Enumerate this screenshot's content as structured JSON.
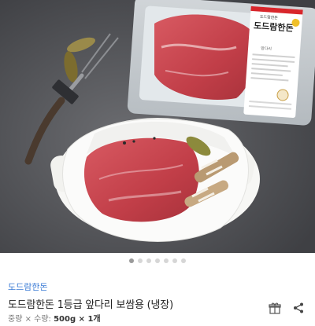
{
  "gallery": {
    "package_label": {
      "brand_badge": "도드람한돈",
      "name": "도드람한돈",
      "detail": "앞다리"
    },
    "page_count": 7,
    "current_page": 1
  },
  "product": {
    "brand": "도드람한돈",
    "title": "도드람한돈 1등급 앞다리 보쌈용 (냉장)",
    "spec_label": "중량 × 수량:",
    "spec_value": "500g × 1개"
  },
  "actions": {
    "gift_icon": "gift-icon",
    "share_icon": "share-icon"
  },
  "colors": {
    "brand_link": "#3a7bd5",
    "label_red": "#d8262b",
    "meat": "#c9444c"
  }
}
